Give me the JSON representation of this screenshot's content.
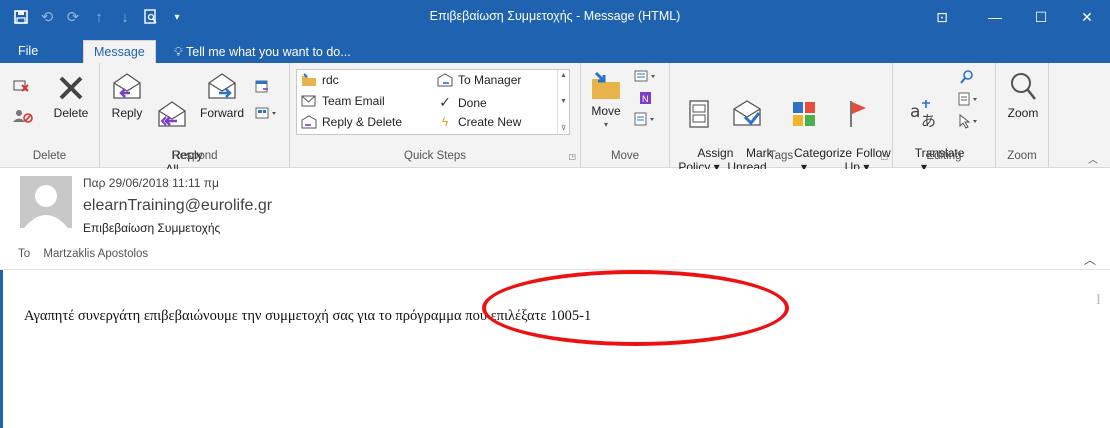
{
  "window": {
    "title": "Επιβεβαίωση Συμμετοχής - Message (HTML)",
    "controls": {
      "ribbon_options": "⊡",
      "minimize": "—",
      "maximize": "☐",
      "close": "✕"
    }
  },
  "quick_access": [
    "save",
    "undo",
    "redo",
    "up",
    "down",
    "search",
    "customize"
  ],
  "tabs": {
    "file": "File",
    "message": "Message",
    "tell_me": "Tell me what you want to do..."
  },
  "ribbon": {
    "groups": {
      "delete": {
        "label": "Delete",
        "delete_label": "Delete"
      },
      "respond": {
        "label": "Respond",
        "reply": "Reply",
        "reply_all": "Reply\nAll",
        "forward": "Forward"
      },
      "quick_steps": {
        "label": "Quick Steps",
        "items": [
          "rdc",
          "Team Email",
          "Reply & Delete",
          "To Manager",
          "Done",
          "Create New"
        ]
      },
      "move": {
        "label": "Move",
        "move": "Move"
      },
      "tags": {
        "label": "Tags",
        "assign_policy": "Assign\nPolicy ▾",
        "mark_unread": "Mark\nUnread",
        "categorize": "Categorize\n▾",
        "follow_up": "Follow\nUp ▾"
      },
      "editing": {
        "label": "Editing",
        "translate": "Translate\n▾"
      },
      "zoom": {
        "label": "Zoom",
        "zoom": "Zoom"
      }
    }
  },
  "message": {
    "date": "Παρ 29/06/2018 11:11 πμ",
    "sender": "elearnTraining@eurolife.gr",
    "subject": "Επιβεβαίωση Συμμετοχής",
    "to_label": "To",
    "to_name": "Martzaklis Apostolos",
    "body": "Αγαπητέ συνεργάτη επιβεβαιώνουμε την συμμετοχή σας για το πρόγραμμα που επιλέξατε 1005-1"
  },
  "colors": {
    "title_bar": "#1e62b0",
    "ribbon": "#f3f3f3",
    "highlight_circle": "#e11111"
  }
}
